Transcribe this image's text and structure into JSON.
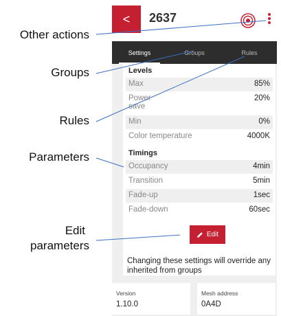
{
  "annotations": {
    "other_actions": "Other actions",
    "groups": "Groups",
    "rules": "Rules",
    "parameters": "Parameters",
    "edit_line1": "Edit",
    "edit_line2": "parameters"
  },
  "header": {
    "back_icon": "chevron-left-icon",
    "title": "2637",
    "status_icon": "target-icon",
    "menu_icon": "kebab-menu-icon"
  },
  "tabs": [
    {
      "label": "Settings",
      "active": true
    },
    {
      "label": "Groups",
      "active": false
    },
    {
      "label": "Rules",
      "active": false
    }
  ],
  "levels": {
    "heading": "Levels",
    "rows": [
      {
        "label": "Max",
        "value": "85%"
      },
      {
        "label": "Power\nsave",
        "value": "20%"
      },
      {
        "label": "Min",
        "value": "0%"
      },
      {
        "label": "Color temperature",
        "value": "4000K"
      }
    ]
  },
  "timings": {
    "heading": "Timings",
    "rows": [
      {
        "label": "Occupancy",
        "value": "4min"
      },
      {
        "label": "Transition",
        "value": "5min"
      },
      {
        "label": "Fade-up",
        "value": "1sec"
      },
      {
        "label": "Fade-down",
        "value": "60sec"
      }
    ]
  },
  "edit_button": {
    "label": "Edit",
    "icon": "pencil-icon"
  },
  "note": "Changing these settings will override any inherited from groups",
  "info": {
    "version_label": "Version",
    "version_value": "1.10.0",
    "mesh_label": "Mesh address",
    "mesh_value": "0A4D"
  },
  "colors": {
    "accent": "#c51f32",
    "tabbar": "#2d2d2d",
    "background": "#efefef"
  }
}
